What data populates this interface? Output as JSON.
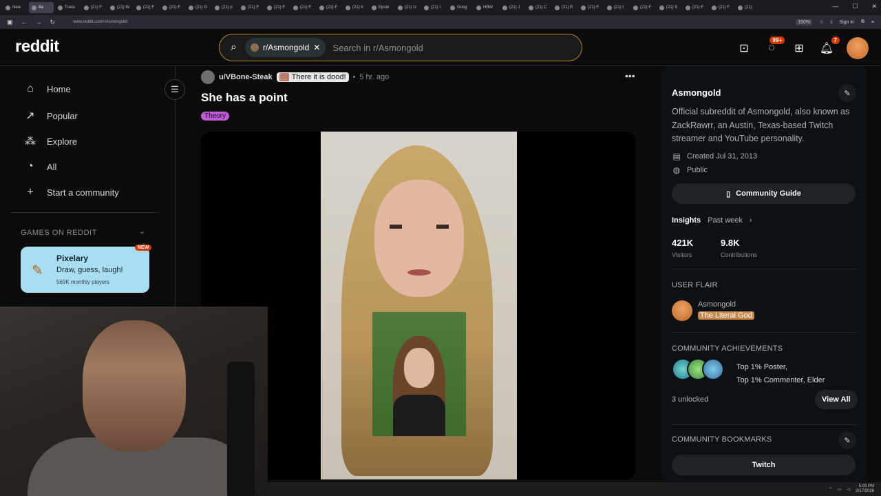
{
  "browser": {
    "tabs": [
      {
        "label": "New",
        "active": false
      },
      {
        "label": "As",
        "active": true
      },
      {
        "label": "Trans",
        "active": false
      },
      {
        "label": "(21) F",
        "active": false
      },
      {
        "label": "(21) W",
        "active": false
      },
      {
        "label": "(21) F",
        "active": false
      },
      {
        "label": "(21) F",
        "active": false
      },
      {
        "label": "(21) G",
        "active": false
      },
      {
        "label": "(21) p",
        "active": false
      },
      {
        "label": "(21) F",
        "active": false
      },
      {
        "label": "(21) F",
        "active": false
      },
      {
        "label": "(21) F",
        "active": false
      },
      {
        "label": "(21) F",
        "active": false
      },
      {
        "label": "(21) h",
        "active": false
      },
      {
        "label": "Epste",
        "active": false
      },
      {
        "label": "(21) U",
        "active": false
      },
      {
        "label": "(21) I",
        "active": false
      },
      {
        "label": "Goog",
        "active": false
      },
      {
        "label": "HBW",
        "active": false
      },
      {
        "label": "(21) J",
        "active": false
      },
      {
        "label": "(21) C",
        "active": false
      },
      {
        "label": "(21) E",
        "active": false
      },
      {
        "label": "(21) F",
        "active": false
      },
      {
        "label": "(21) I",
        "active": false
      },
      {
        "label": "(21) F",
        "active": false
      },
      {
        "label": "(21) S",
        "active": false
      },
      {
        "label": "(21) F",
        "active": false
      },
      {
        "label": "(21) F",
        "active": false
      },
      {
        "label": "(21)",
        "active": false
      }
    ],
    "url": "www.reddit.com/r/Asmongold/",
    "zoom": "150%",
    "signin": "Sign in"
  },
  "header": {
    "logo": "reddit",
    "search_chip": "r/Asmongold",
    "search_placeholder": "Search in r/Asmongold",
    "chat_badge": "99+",
    "notif_badge": "7"
  },
  "sidebar": {
    "items": [
      {
        "label": "Home",
        "icon": "home-icon"
      },
      {
        "label": "Popular",
        "icon": "popular-icon"
      },
      {
        "label": "Explore",
        "icon": "explore-icon"
      },
      {
        "label": "All",
        "icon": "all-icon"
      },
      {
        "label": "Start a community",
        "icon": "plus-icon"
      }
    ],
    "games_title": "GAMES ON REDDIT",
    "game": {
      "title": "Pixelary",
      "subtitle": "Draw, guess, laugh!",
      "players": "569K monthly players",
      "badge": "NEW"
    }
  },
  "post": {
    "user": "u/VBone-Steak",
    "flair": "There it is dood!",
    "time": "5 hr. ago",
    "title": "She has a point",
    "tag": "Theory"
  },
  "community": {
    "name": "Asmongold",
    "description": "Official subreddit of Asmongold, also known as ZackRawrr, an Austin, Texas-based Twitch streamer and YouTube personality.",
    "created": "Created Jul 31, 2013",
    "visibility": "Public",
    "guide_label": "Community Guide",
    "insights_label": "Insights",
    "insights_range": "Past week",
    "visitors_value": "421K",
    "visitors_label": "Visitors",
    "contrib_value": "9.8K",
    "contrib_label": "Contributions",
    "user_flair_title": "USER FLAIR",
    "flair_user": "Asmongold",
    "flair_text": "The Literal God",
    "achievements_title": "COMMUNITY ACHIEVEMENTS",
    "achievements_line1": "Top 1% Poster,",
    "achievements_line2": "Top 1% Commenter, Elder",
    "unlocked": "3 unlocked",
    "view_all": "View All",
    "bookmarks_title": "COMMUNITY BOOKMARKS",
    "bookmark": "Twitch"
  },
  "taskbar": {
    "time": "5:03 PM",
    "date": "2/17/2026"
  }
}
